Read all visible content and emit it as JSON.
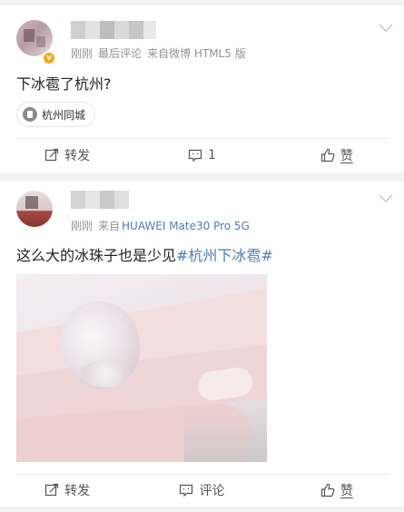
{
  "posts": [
    {
      "meta": {
        "time": "刚刚",
        "extra": "最后评论",
        "source": "来自微博 HTML5 版"
      },
      "text": "下冰雹了杭州?",
      "topic": {
        "icon": "city-icon",
        "label": "杭州同城"
      },
      "actions": {
        "repost": "转发",
        "comment": "1",
        "like": "赞"
      }
    },
    {
      "meta": {
        "time": "刚刚",
        "source_prefix": "来自",
        "source": "HUAWEI Mate30 Pro 5G"
      },
      "text": "这么大的冰珠子也是少见",
      "hashtag": "#杭州下冰雹#",
      "actions": {
        "repost": "转发",
        "comment": "评论",
        "like": "赞"
      }
    }
  ],
  "colors": {
    "link": "#507daf",
    "meta": "#939393",
    "badge": "#f5a623"
  }
}
